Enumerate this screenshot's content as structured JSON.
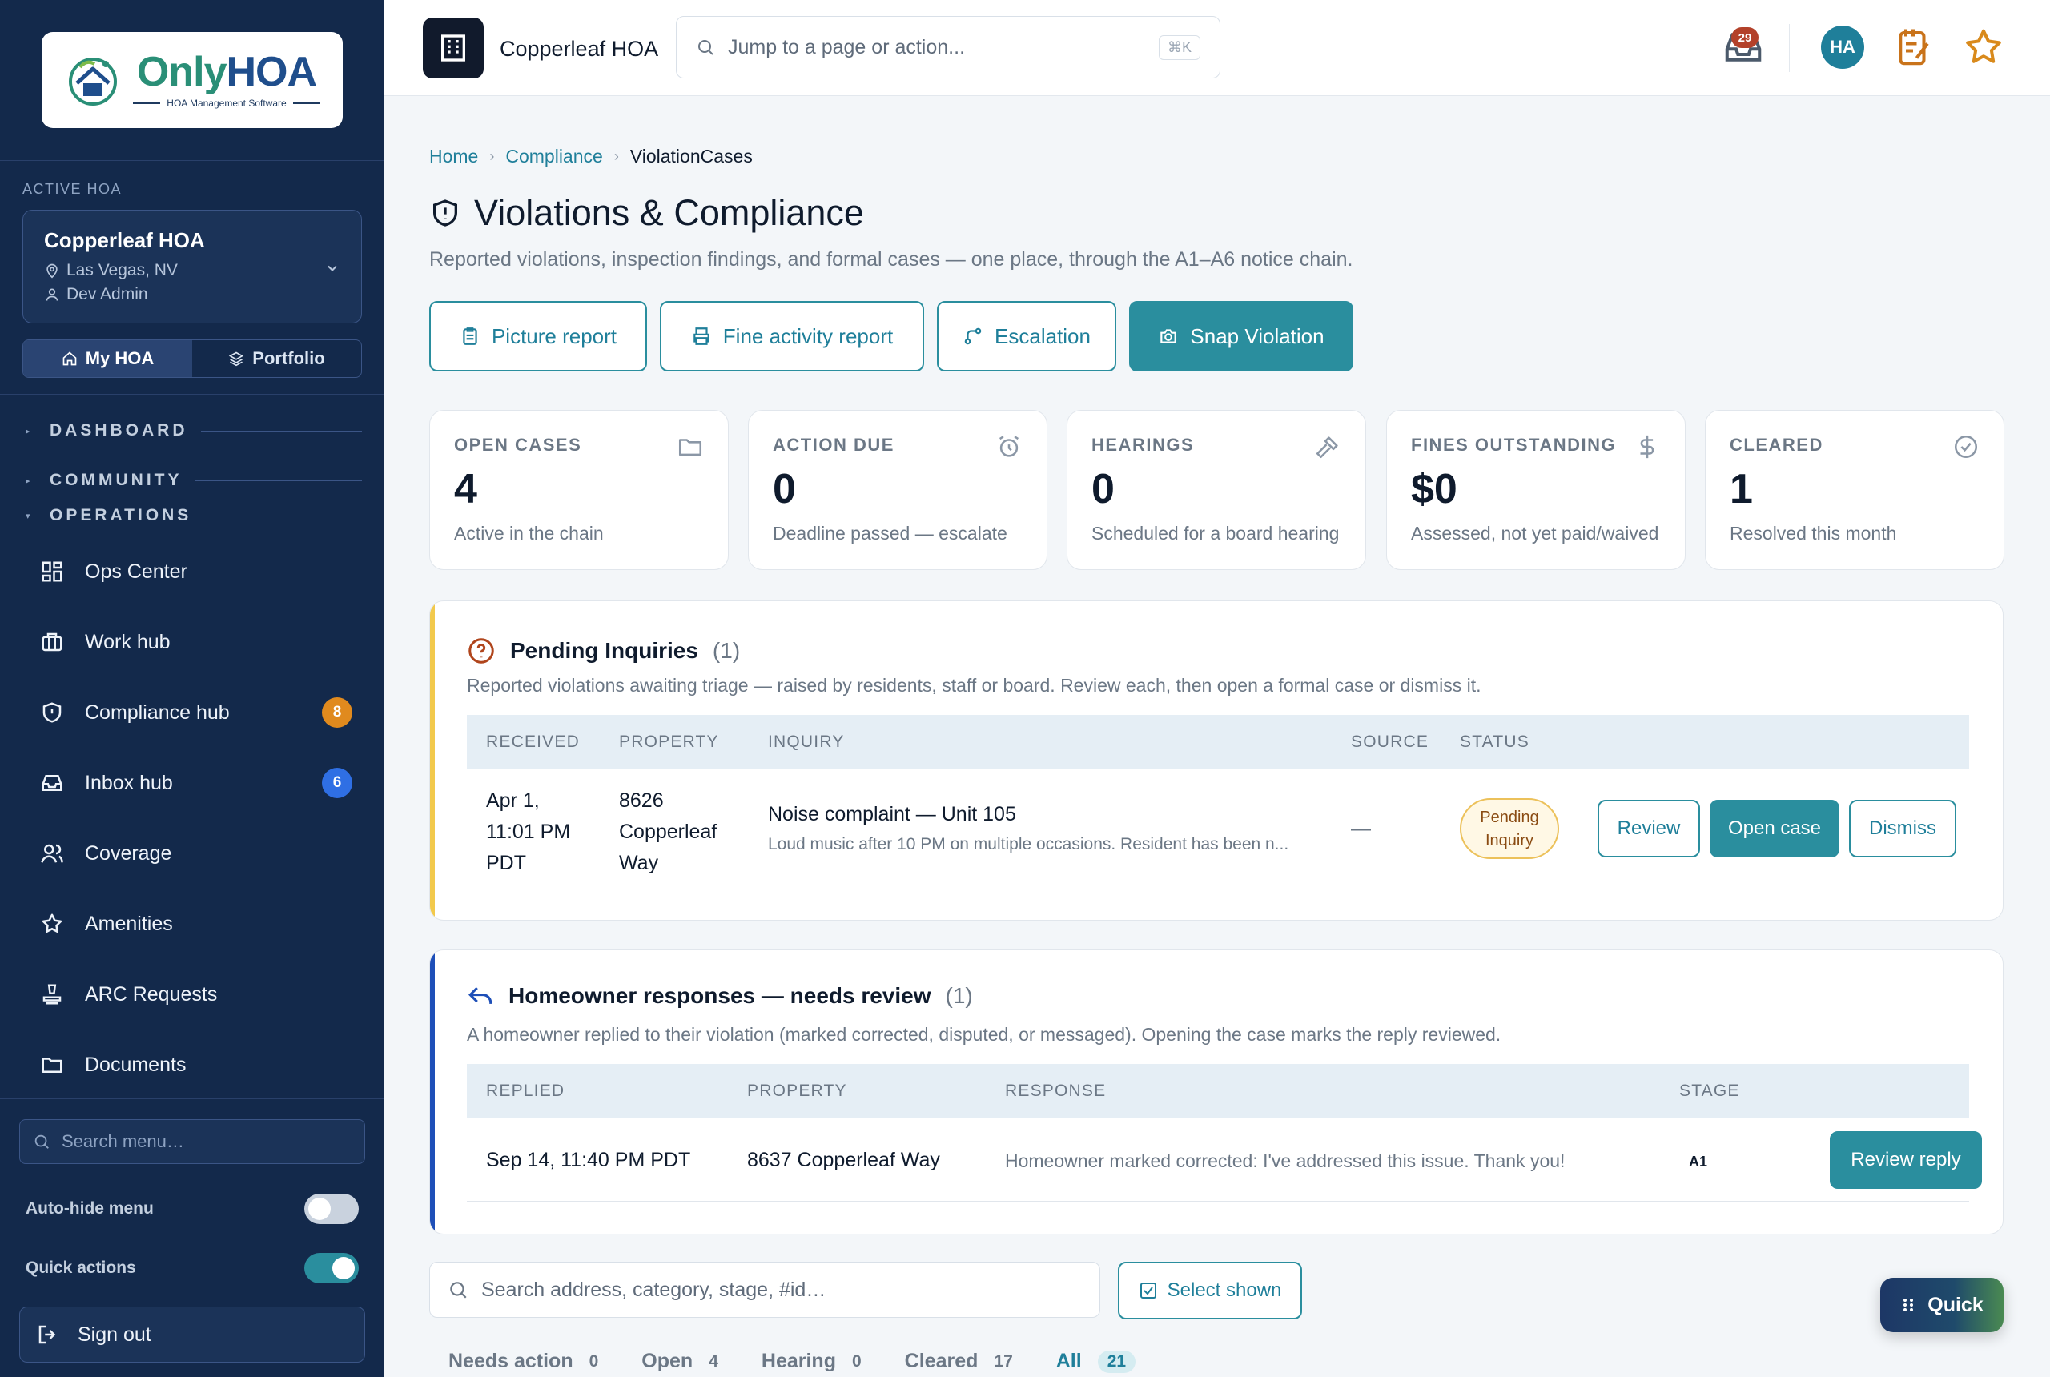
{
  "brand": {
    "logo_only": "Only",
    "logo_hoa": "HOA",
    "logo_sub": "HOA Management Software"
  },
  "sidebar": {
    "active_label": "ACTIVE HOA",
    "hoa_name": "Copperleaf HOA",
    "hoa_location": "Las Vegas, NV",
    "hoa_user": "Dev Admin",
    "seg_my_hoa": "My HOA",
    "seg_portfolio": "Portfolio",
    "sections": {
      "dashboard": "DASHBOARD",
      "community": "COMMUNITY",
      "operations": "OPERATIONS"
    },
    "items": [
      {
        "label": "Ops Center",
        "icon": "grid-icon"
      },
      {
        "label": "Work hub",
        "icon": "briefcase-icon"
      },
      {
        "label": "Compliance hub",
        "icon": "shield-icon",
        "badge": "8"
      },
      {
        "label": "Inbox hub",
        "icon": "inbox-icon",
        "badge": "6"
      },
      {
        "label": "Coverage",
        "icon": "users-icon"
      },
      {
        "label": "Amenities",
        "icon": "star-icon"
      },
      {
        "label": "ARC Requests",
        "icon": "stamp-icon"
      },
      {
        "label": "Documents",
        "icon": "folder-icon"
      }
    ],
    "search_placeholder": "Search menu…",
    "auto_hide_label": "Auto-hide menu",
    "auto_hide_on": false,
    "quick_actions_label": "Quick actions",
    "quick_actions_on": true,
    "sign_out": "Sign out"
  },
  "topbar": {
    "title": "Copperleaf HOA",
    "search_placeholder": "Jump to a page or action...",
    "search_kbd": "⌘K",
    "notification_count": "29",
    "avatar_initials": "HA"
  },
  "breadcrumb": {
    "home": "Home",
    "compliance": "Compliance",
    "current": "ViolationCases"
  },
  "page": {
    "title": "Violations & Compliance",
    "subtitle": "Reported violations, inspection findings, and formal cases — one place, through the A1–A6 notice chain."
  },
  "actions": {
    "picture_report": "Picture report",
    "fine_activity_report": "Fine activity report",
    "escalation": "Escalation",
    "snap_violation": "Snap Violation"
  },
  "stats": [
    {
      "label": "OPEN CASES",
      "value": "4",
      "desc": "Active in the chain",
      "icon": "folder-icon"
    },
    {
      "label": "ACTION DUE",
      "value": "0",
      "desc": "Deadline passed — escalate",
      "icon": "alarm-icon"
    },
    {
      "label": "HEARINGS",
      "value": "0",
      "desc": "Scheduled for a board hearing",
      "icon": "gavel-icon"
    },
    {
      "label": "FINES OUTSTANDING",
      "value": "$0",
      "desc": "Assessed, not yet paid/waived",
      "icon": "dollar-icon"
    },
    {
      "label": "CLEARED",
      "value": "1",
      "desc": "Resolved this month",
      "icon": "check-circle-icon"
    }
  ],
  "inquiries": {
    "title": "Pending Inquiries",
    "count": "(1)",
    "subtitle": "Reported violations awaiting triage — raised by residents, staff or board. Review each, then open a formal case or dismiss it.",
    "columns": {
      "received": "RECEIVED",
      "property": "PROPERTY",
      "inquiry": "INQUIRY",
      "source": "SOURCE",
      "status": "STATUS"
    },
    "row": {
      "received_1": "Apr 1,",
      "received_2": "11:01 PM",
      "received_3": "PDT",
      "property_1": "8626",
      "property_2": "Copperleaf",
      "property_3": "Way",
      "inquiry_title": "Noise complaint — Unit 105",
      "inquiry_desc": "Loud music after 10 PM on multiple occasions. Resident has been n...",
      "source": "—",
      "status_1": "Pending",
      "status_2": "Inquiry",
      "review": "Review",
      "open_case": "Open case",
      "dismiss": "Dismiss"
    }
  },
  "responses": {
    "title": "Homeowner responses — needs review",
    "count": "(1)",
    "subtitle": "A homeowner replied to their violation (marked corrected, disputed, or messaged). Opening the case marks the reply reviewed.",
    "columns": {
      "replied": "REPLIED",
      "property": "PROPERTY",
      "response": "RESPONSE",
      "stage": "STAGE"
    },
    "row": {
      "replied": "Sep 14, 11:40 PM PDT",
      "property": "8637 Copperleaf Way",
      "response": "Homeowner marked corrected: I've addressed this issue. Thank you!",
      "stage": "A1",
      "review_reply": "Review reply"
    }
  },
  "cases": {
    "search_placeholder": "Search address, category, stage, #id…",
    "select_shown": "Select shown",
    "tabs": [
      {
        "label": "Needs action",
        "count": "0"
      },
      {
        "label": "Open",
        "count": "4"
      },
      {
        "label": "Hearing",
        "count": "0"
      },
      {
        "label": "Cleared",
        "count": "17"
      },
      {
        "label": "All",
        "count": "21"
      }
    ]
  },
  "quick_button": "Quick",
  "colors": {
    "sidebar": "#13294b",
    "accent": "#2a8e9e",
    "warning_accent": "#f2c94c",
    "info_accent": "#1e4fb8"
  }
}
